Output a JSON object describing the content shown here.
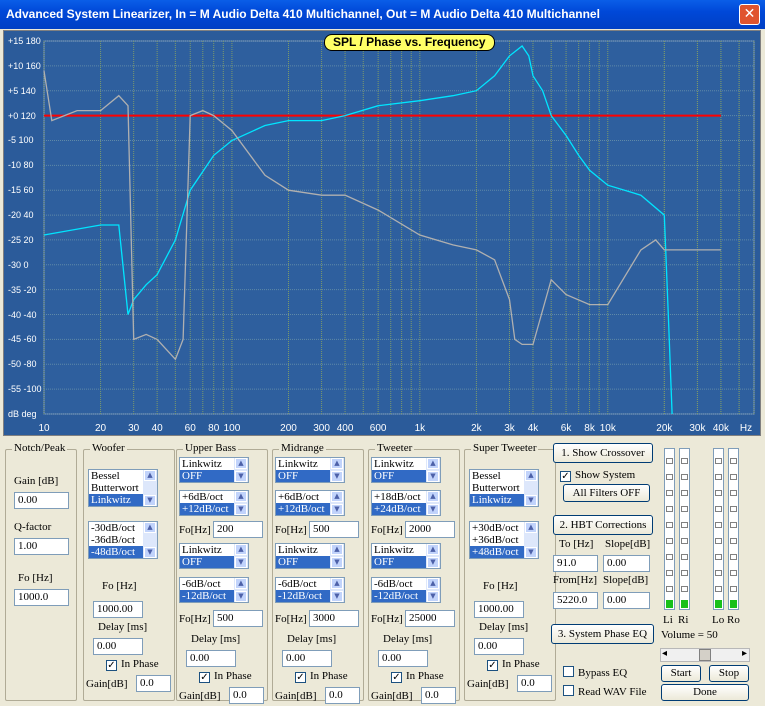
{
  "window": {
    "title": "Advanced System Linearizer, In = M Audio Delta 410 Multichannel, Out = M Audio Delta 410 Multichannel",
    "close_glyph": "✕"
  },
  "chart_data": {
    "type": "line",
    "title": "SPL / Phase vs. Frequency",
    "xlabel": "Hz",
    "ylabel_left": "dB",
    "ylabel_right": "deg",
    "x_ticks": [
      "10",
      "20",
      "30",
      "40",
      "60",
      "80",
      "100",
      "200",
      "300",
      "400",
      "600",
      "1k",
      "2k",
      "3k",
      "4k",
      "6k",
      "8k",
      "10k",
      "20k",
      "30k",
      "40k",
      "Hz"
    ],
    "y_ticks": [
      "+15 180",
      "+10 160",
      "+5 140",
      "+0 120",
      "-5 100",
      "-10 80",
      "-15 60",
      "-20 40",
      "-25 20",
      "-30 0",
      "-35 -20",
      "-40 -40",
      "-45 -60",
      "-50 -80",
      "-55 -100",
      "dB deg"
    ],
    "xlim": [
      10,
      60000
    ],
    "ylim_db": [
      -60,
      15
    ],
    "ylim_deg": [
      -120,
      180
    ],
    "x_scale": "log",
    "grid": true,
    "series": [
      {
        "color": "#ff0000",
        "x": [
          10,
          40000
        ],
        "y": [
          0,
          0
        ]
      },
      {
        "color": "#00e5ff",
        "x": [
          10,
          20,
          25,
          28,
          30,
          35,
          40,
          50,
          60,
          80,
          100,
          150,
          200,
          300,
          400,
          600,
          1000,
          1500,
          2000,
          2500,
          3000,
          3500,
          3800,
          4000,
          4500,
          5000,
          6000,
          7000,
          8000,
          10000,
          15000,
          20000,
          21000,
          22000
        ],
        "y": [
          -24,
          -22,
          -22,
          -40,
          -37,
          -34,
          -32,
          -25,
          -15,
          -8,
          -5,
          -2,
          -1,
          -1,
          0,
          2,
          3,
          4,
          5,
          8,
          12,
          14,
          12,
          8,
          5,
          0,
          -4,
          -8,
          -11,
          -14,
          -16,
          -20,
          -40,
          -60
        ]
      },
      {
        "color": "#b0b0b0",
        "x": [
          10,
          11,
          15,
          20,
          25,
          28,
          30,
          35,
          40,
          50,
          55,
          60,
          70,
          80,
          100,
          150,
          200,
          300,
          400,
          600,
          1000,
          1500,
          2000,
          2500,
          3000,
          3200,
          3500,
          4000,
          5000,
          6000,
          8000,
          10000,
          15000,
          18000,
          20000,
          25000,
          40000
        ],
        "y": [
          9,
          -1,
          1,
          1,
          4,
          2,
          -45,
          -44,
          -45,
          -49,
          -45,
          0,
          1,
          0,
          -3,
          -12,
          -15,
          -16,
          -16,
          -19,
          -24,
          -26,
          -27,
          -29,
          -37,
          -45,
          -46,
          -46,
          -33,
          -36,
          -38,
          -38,
          -27,
          -25,
          -27,
          -27,
          -27
        ]
      }
    ]
  },
  "notch": {
    "title": "Notch/Peak",
    "gain_label": "Gain [dB]",
    "gain": "0.00",
    "q_label": "Q-factor",
    "q": "1.00",
    "fo_label": "Fo [Hz]",
    "fo": "1000.0"
  },
  "woofer": {
    "title": "Woofer",
    "type_items": [
      "Bessel",
      "Butterwort",
      "Linkwitz"
    ],
    "slope_items": [
      "-30dB/oct",
      "-36dB/oct",
      "-48dB/oct"
    ],
    "fo_label": "Fo [Hz]",
    "fo": "1000.00",
    "delay_label": "Delay [ms]",
    "delay": "0.00",
    "phase_label": "In Phase",
    "gain_label": "Gain[dB]",
    "gain": "0.0"
  },
  "upper_bass": {
    "title": "Upper Bass",
    "hp_type": [
      "Linkwitz",
      "OFF"
    ],
    "hp_slope": [
      "+6dB/oct",
      "+12dB/oct"
    ],
    "fo1_label": "Fo[Hz]",
    "fo1": "200",
    "lp_type": [
      "Linkwitz",
      "OFF"
    ],
    "lp_slope": [
      "-6dB/oct",
      "-12dB/oct"
    ],
    "fo2_label": "Fo[Hz]",
    "fo2": "500",
    "delay_label": "Delay [ms]",
    "delay": "0.00",
    "phase_label": "In Phase",
    "gain_label": "Gain[dB]",
    "gain": "0.0"
  },
  "midrange": {
    "title": "Midrange",
    "hp_type": [
      "Linkwitz",
      "OFF"
    ],
    "hp_slope": [
      "+6dB/oct",
      "+12dB/oct"
    ],
    "fo1_label": "Fo[Hz]",
    "fo1": "500",
    "lp_type": [
      "Linkwitz",
      "OFF"
    ],
    "lp_slope": [
      "-6dB/oct",
      "-12dB/oct"
    ],
    "fo2_label": "Fo[Hz]",
    "fo2": "3000",
    "delay_label": "Delay [ms]",
    "delay": "0.00",
    "phase_label": "In Phase",
    "gain_label": "Gain[dB]",
    "gain": "0.0"
  },
  "tweeter": {
    "title": "Tweeter",
    "hp_type": [
      "Linkwitz",
      "OFF"
    ],
    "hp_slope": [
      "+18dB/oct",
      "+24dB/oct"
    ],
    "fo1_label": "Fo[Hz]",
    "fo1": "2000",
    "lp_type": [
      "Linkwitz",
      "OFF"
    ],
    "lp_slope": [
      "-6dB/oct",
      "-12dB/oct"
    ],
    "fo2_label": "Fo[Hz]",
    "fo2": "25000",
    "delay_label": "Delay [ms]",
    "delay": "0.00",
    "phase_label": "In Phase",
    "gain_label": "Gain[dB]",
    "gain": "0.0"
  },
  "super_tweeter": {
    "title": "Super Tweeter",
    "type_items": [
      "Bessel",
      "Butterwort",
      "Linkwitz"
    ],
    "slope_items": [
      "+30dB/oct",
      "+36dB/oct",
      "+48dB/oct"
    ],
    "fo_label": "Fo [Hz]",
    "fo": "1000.00",
    "delay_label": "Delay [ms]",
    "delay": "0.00",
    "phase_label": "In Phase",
    "gain_label": "Gain[dB]",
    "gain": "0.0"
  },
  "controls": {
    "show_crossover": "1. Show Crossover",
    "show_system": "Show System",
    "all_filters_off": "All Filters OFF",
    "hbt_corrections": "2. HBT Corrections",
    "to_label": "To [Hz]",
    "slope_label": "Slope[dB]",
    "to": "91.0",
    "to_slope": "0.00",
    "from_label": "From[Hz]",
    "from_slope_label": "Slope[dB]",
    "from": "5220.0",
    "from_slope": "0.00",
    "system_phase_eq": "3. System Phase EQ",
    "bypass_eq": "Bypass EQ",
    "read_wav": "Read WAV File",
    "start": "Start",
    "stop": "Stop",
    "done": "Done",
    "volume_label": "Volume = 50",
    "volume": 50,
    "check_mark": "✓",
    "arrow_left": "◂",
    "arrow_right": "▸"
  },
  "meters": {
    "labels": [
      "Li",
      "Ri",
      "Lo",
      "Ro"
    ],
    "levels": [
      0.02,
      0.02,
      0.02,
      0.02
    ]
  }
}
